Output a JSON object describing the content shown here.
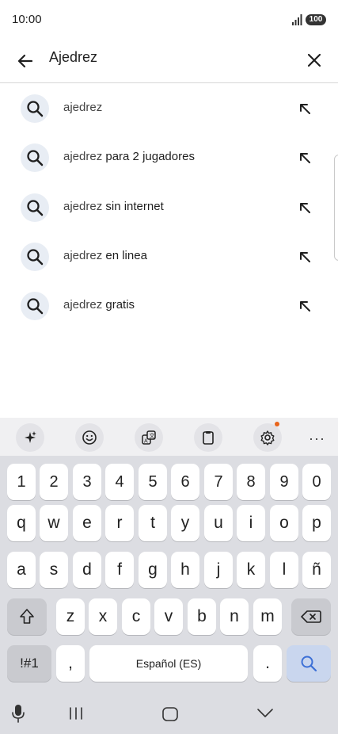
{
  "status": {
    "time": "10:00",
    "battery": "100"
  },
  "search": {
    "query": "Ajedrez"
  },
  "suggestions": [
    {
      "match": "ajedrez",
      "rest": ""
    },
    {
      "match": "ajedrez",
      "rest": " para 2 jugadores"
    },
    {
      "match": "ajedrez",
      "rest": " sin internet"
    },
    {
      "match": "ajedrez",
      "rest": " en linea"
    },
    {
      "match": "ajedrez",
      "rest": " gratis"
    }
  ],
  "keyboard": {
    "toolbar": [
      "sparkle-icon",
      "emoji-icon",
      "translate-icon",
      "clipboard-icon",
      "settings-icon",
      "more-icon"
    ],
    "row_numbers": [
      "1",
      "2",
      "3",
      "4",
      "5",
      "6",
      "7",
      "8",
      "9",
      "0"
    ],
    "row1": [
      "q",
      "w",
      "e",
      "r",
      "t",
      "y",
      "u",
      "i",
      "o",
      "p"
    ],
    "row2": [
      "a",
      "s",
      "d",
      "f",
      "g",
      "h",
      "j",
      "k",
      "l",
      "ñ"
    ],
    "row3": [
      "z",
      "x",
      "c",
      "v",
      "b",
      "n",
      "m"
    ],
    "symbols_label": "!#1",
    "comma": ",",
    "space_label": "Español (ES)",
    "period": ".",
    "accent_color": "#3b6fd6"
  },
  "navbar": [
    "mic-icon",
    "recents-icon",
    "home-icon",
    "back-down-icon"
  ]
}
